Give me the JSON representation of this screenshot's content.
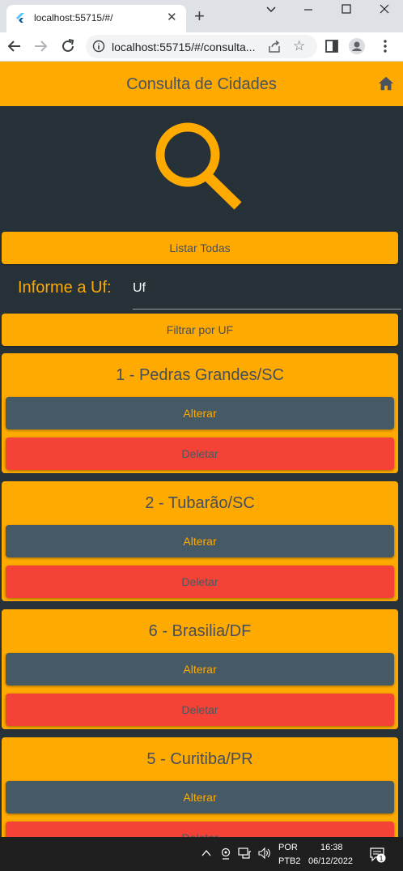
{
  "browser": {
    "tab_title": "localhost:55715/#/",
    "tab_close": "✕",
    "new_tab": "+",
    "url": "localhost:55715/#/consulta...",
    "window_controls": {
      "minimize": "—",
      "maximize": "☐",
      "close": "✕"
    }
  },
  "app": {
    "title": "Consulta de Cidades",
    "accent_color": "#ffaa00",
    "background_color": "#263238",
    "list_all_label": "Listar Todas",
    "uf_label": "Informe a Uf:",
    "uf_input_value": "Uf",
    "filter_label": "Filtrar por UF"
  },
  "cities": [
    {
      "title": "1 - Pedras Grandes/SC",
      "edit_label": "Alterar",
      "delete_label": "Deletar"
    },
    {
      "title": "2 - Tubarão/SC",
      "edit_label": "Alterar",
      "delete_label": "Deletar"
    },
    {
      "title": "6 - Brasilia/DF",
      "edit_label": "Alterar",
      "delete_label": "Deletar"
    },
    {
      "title": "5 - Curitiba/PR",
      "edit_label": "Alterar",
      "delete_label": "Deletar"
    }
  ],
  "taskbar": {
    "lang_line1": "POR",
    "lang_line2": "PTB2",
    "time": "16:38",
    "date": "06/12/2022",
    "notification_count": "1"
  }
}
